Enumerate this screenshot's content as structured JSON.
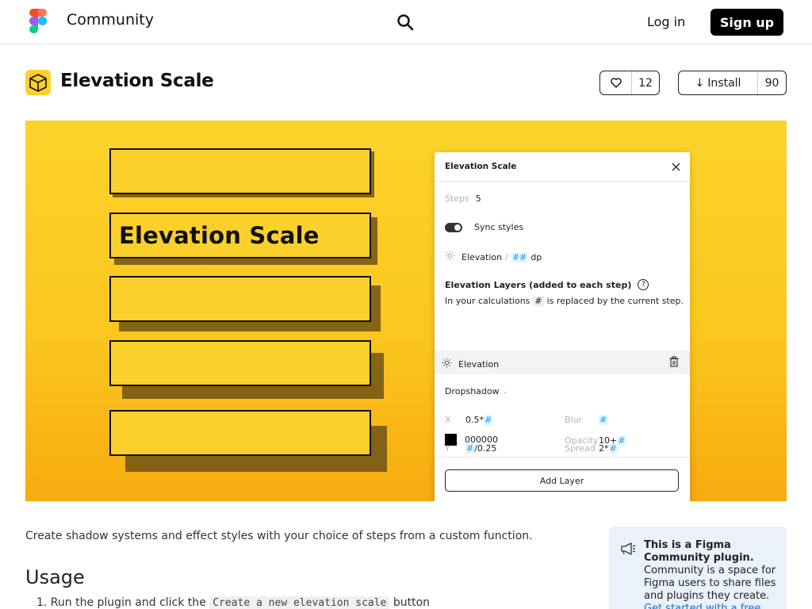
{
  "nav": {
    "brand": "Community",
    "login": "Log in",
    "signup": "Sign up"
  },
  "header": {
    "title": "Elevation Scale",
    "likes": "12",
    "install_label": "Install",
    "installs": "90"
  },
  "hero": {
    "card_title": "Elevation Scale",
    "panel": {
      "title": "Elevation Scale",
      "steps_label": "Steps",
      "steps_value": "5",
      "sync_label": "Sync styles",
      "name_prefix": "Elevation",
      "name_sep": "/",
      "name_hash": "##",
      "name_suffix": "dp",
      "layers_heading": "Elevation Layers (added to each step)",
      "help_icon": "?",
      "calc_pre": "In your calculations",
      "calc_hash": "#",
      "calc_post": "is replaced by the current step.",
      "layer_name": "Elevation",
      "effect_type": "Dropshadow",
      "x_label": "X",
      "x_value": "0.5*",
      "x_hash": "#",
      "blur_label": "Blur",
      "blur_hash": "#",
      "y_label": "Y",
      "y_hash": "#",
      "y_value": "/0.25",
      "spread_label": "Spread",
      "spread_value": "2*",
      "spread_hash": "#",
      "color_value": "000000",
      "opacity_label": "Opacity",
      "opacity_value": "10+",
      "opacity_hash": "#",
      "add_layer": "Add Layer"
    }
  },
  "content": {
    "description": "Create shadow systems and effect styles with your choice of steps from a custom function.",
    "usage_heading": "Usage",
    "step1_pre": "1. Run the plugin and click the",
    "step1_code": "Create a new elevation scale",
    "step1_post": "button"
  },
  "notice": {
    "bold": "This is a Figma Community plugin.",
    "body": "Community is a space for Figma users to share files and plugins they create.",
    "link": "Get started with a free account →"
  },
  "colors": {
    "hero_yellow": "#fcd32c",
    "hero_orange": "#f7ab10",
    "link_blue": "#18a0fb",
    "black": "#000000"
  }
}
